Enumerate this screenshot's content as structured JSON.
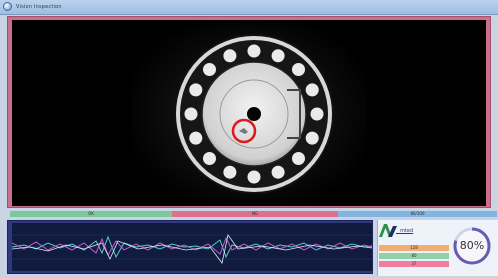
{
  "window": {
    "title": "Vision  Inspection"
  },
  "status_bar": {
    "segments": [
      {
        "label": "OK",
        "color": "#7bc89a"
      },
      {
        "label": "NG",
        "color": "#e07090"
      },
      {
        "label": "80/100",
        "color": "#84b4e2"
      }
    ]
  },
  "logo": {
    "text": "_ mted"
  },
  "stats": {
    "s1": "128",
    "s2": "80",
    "s3": "37"
  },
  "gauge": {
    "value": 80,
    "label": "80%"
  },
  "colors": {
    "accent": "#c96f8c",
    "panel": "#2f3a7e",
    "gauge_ring": "#6a5bb0"
  }
}
